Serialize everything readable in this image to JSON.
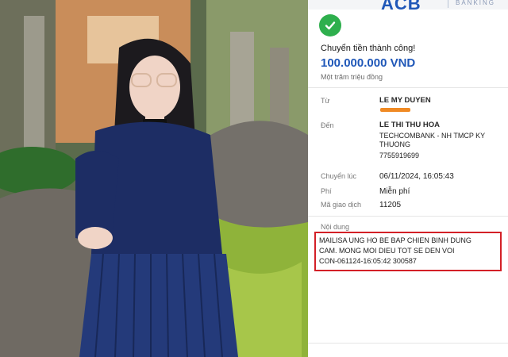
{
  "receipt": {
    "bank_name": "ACB",
    "bank_sub": "BANKING",
    "status": "Chuyển tiền thành công!",
    "amount": "100.000.000 VND",
    "amount_words": "Một trăm triệu đồng",
    "from_label": "Từ",
    "from_name": "LE MY DUYEN",
    "to_label": "Đến",
    "to_name": "LE THI THU HOA",
    "to_bank_line1": "TECHCOMBANK - NH TMCP KY",
    "to_bank_line2": "THUONG",
    "to_account": "7755919699",
    "time_label": "Chuyển lúc",
    "time_value": "06/11/2024, 16:05:43",
    "fee_label": "Phí",
    "fee_value": "Miễn phí",
    "txn_label": "Mã giao dịch",
    "txn_value": "11205",
    "content_label": "Nội dung",
    "content_line1": "MAILISA UNG HO BE BAP CHIEN BINH DUNG",
    "content_line2": "CAM. MONG MOI DIEU TOT SE DEN VOI",
    "content_line3": "CON-061124-16:05:42 300587"
  },
  "colors": {
    "accent_blue": "#1f57b8",
    "success_green": "#2eaf4d",
    "highlight_red": "#d32027",
    "redaction_orange": "#f08a24"
  },
  "icons": [
    "check-icon"
  ]
}
